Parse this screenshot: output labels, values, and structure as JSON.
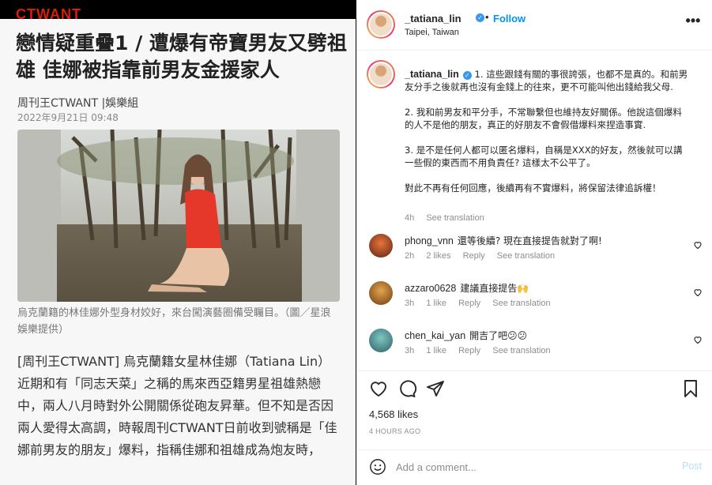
{
  "article": {
    "logo": "CTWANT",
    "headline": "戀情疑重疊1 / 遭爆有帝寶男友又劈祖雄 佳娜被指靠前男友金援家人",
    "byline": "周刊王CTWANT |娛樂組",
    "date": "2022年9月21日 09:48",
    "caption": "烏克蘭籍的林佳娜外型身材姣好，來台闖演藝圈備受矚目。（圖／星浪娛樂提供）",
    "body": "[周刊王CTWANT] 烏克蘭籍女星林佳娜（Tatiana Lin）近期和有「同志天菜」之稱的馬來西亞籍男星祖雄熱戀中，兩人八月時對外公開關係從砲友昇華。但不知是否因兩人愛得太高調，時報周刊CTWANT日前收到號稱是「佳娜前男友的朋友」爆料，指稱佳娜和祖雄成為炮友時，",
    "photo_icon": "article-photo"
  },
  "post": {
    "username": "_tatiana_lin",
    "verified_icon": "verified-badge-icon",
    "separator": "•",
    "follow_label": "Follow",
    "location": "Taipei, Taiwan",
    "more_icon": "more-options-icon",
    "more_glyph": "•••",
    "caption": {
      "username": "_tatiana_lin",
      "paragraphs": [
        "1. 這些跟錢有關的事很誇張，也都不是真的。和前男友分手之後就再也沒有金錢上的往來，更不可能叫他出錢給我父母.",
        "2. 我和前男友和平分手，不常聯繫但也維持友好關係。他說這個爆料的人不是他的朋友，真正的好朋友不會假借爆料來捏造事實.",
        "3. 是不是任何人都可以匿名爆料，自稱是XXX的好友，然後就可以講一些假的東西而不用負責任? 這樣太不公平了。",
        "對此不再有任何回應，後續再有不實爆料，將保留法律追訴權！"
      ],
      "time": "4h",
      "see_translation": "See translation"
    },
    "comments": [
      {
        "username": "phong_vnn",
        "text": "還等後續? 現在直接提告就對了啊!",
        "time": "2h",
        "likes": "2 likes",
        "reply": "Reply",
        "see_translation": "See translation",
        "avatar_color": "#b8502e"
      },
      {
        "username": "azzaro0628",
        "text": "建議直接提告🙌",
        "time": "3h",
        "likes": "1 like",
        "reply": "Reply",
        "see_translation": "See translation",
        "avatar_color": "#c07a30"
      },
      {
        "username": "chen_kai_yan",
        "text": "開吉了吧😕😕",
        "time": "3h",
        "likes": "1 like",
        "reply": "Reply",
        "see_translation": "See translation",
        "avatar_color": "#3f8a8a"
      }
    ],
    "likes_count": "4,568 likes",
    "posted_ago": "4 HOURS AGO",
    "add_comment_placeholder": "Add a comment...",
    "post_label": "Post",
    "icons": [
      "heart-icon",
      "comment-icon",
      "share-icon",
      "save-icon",
      "emoji-icon"
    ],
    "colors": {
      "link": "#0095f6",
      "muted": "#8e8e8e",
      "text": "#262626",
      "post_disabled": "#b2dffc"
    }
  }
}
